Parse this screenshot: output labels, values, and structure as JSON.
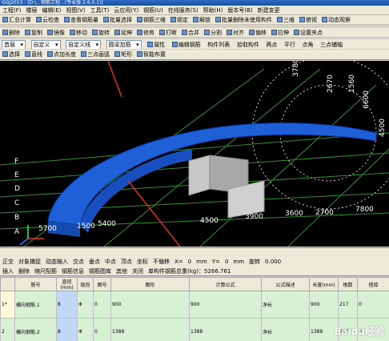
{
  "window": {
    "title": "GGJ2013 - [D:\\...钢筋工程...(专业版 2.6.0.1)]"
  },
  "menu": [
    "工程(F)",
    "楼层",
    "编辑(E)",
    "视图(V)",
    "工具(T)",
    "云应用(Y)",
    "钢筋(U)",
    "在线服务(S)",
    "帮助(H)",
    "版本号(B)",
    "新建变更"
  ],
  "toolbar1": [
    "汇总计算",
    "云检查",
    "查看钢筋量",
    "批量选择",
    "钢筋三维",
    "锁定",
    "解锁",
    "批量删除未使用构件",
    "三维",
    "俯视",
    "动态观察"
  ],
  "toolbar2": [
    "删除",
    "复制",
    "镜像",
    "移动",
    "旋转",
    "延伸",
    "修剪",
    "打断",
    "合并",
    "分割",
    "对齐",
    "偏移",
    "拉伸",
    "设置夹点"
  ],
  "selectors": {
    "floor": "首层",
    "category": "自定义",
    "type": "自定义线",
    "name": "圆梁加筋",
    "props": "属性",
    "edit": "编辑钢筋",
    "list": "构件列表",
    "pick": "拾取构件",
    "twopoint": "两点",
    "parallel": "平行",
    "corner": "点角",
    "three": "三点辅轴"
  },
  "drawbar": [
    "选择",
    "直线",
    "点加长度",
    "三点画弧",
    "矩形",
    "智能布置"
  ],
  "viewport": {
    "left_axes": [
      "F",
      "E",
      "D",
      "C",
      "B",
      "A"
    ],
    "bottom_dims": [
      "5700",
      "1500",
      "5400",
      "4500",
      "3900",
      "3600",
      "2700",
      "7800"
    ],
    "top_dims": [
      "3780",
      "2670",
      "1560",
      "6600",
      "4500"
    ],
    "colors": {
      "beam": "#1f5fd8",
      "grid": "#2f8f2f",
      "wall": "#c8c8c8"
    }
  },
  "statusbar": [
    "正交",
    "对象捕捉",
    "动态输入",
    "交点",
    "垂点",
    "中点",
    "顶点",
    "坐标",
    "不偏移",
    "X=",
    "0",
    "mm",
    "Y=",
    "0",
    "mm",
    "旋转",
    "0.000"
  ],
  "rebarbar": {
    "buttons": [
      "插入",
      "删除",
      "缩尺配筋",
      "钢筋信息",
      "钢筋图库",
      "其他",
      "关闭"
    ],
    "total": "单构件钢筋总重(kg)：5266.761"
  },
  "table": {
    "headers": [
      "",
      "筋号",
      "直径(mm)",
      "级别",
      "图号",
      "图形",
      "计算公式",
      "公式描述",
      "长度(mm)",
      "根数",
      "搭接"
    ],
    "rows": [
      {
        "idx": "1*",
        "name": "横向钢筋.1",
        "dia": "8",
        "grade": "Φ",
        "fig": "0",
        "shape": "900",
        "formula": "900",
        "desc": "净长",
        "len": "900",
        "count": "217",
        "lap": "0"
      },
      {
        "idx": "2",
        "name": "横向钢筋.2",
        "dia": "8",
        "grade": "Φ",
        "fig": "0",
        "shape": "1388",
        "formula": "1388",
        "desc": "净长",
        "len": "1388",
        "count": "217",
        "lap": "0"
      }
    ]
  },
  "watermark": "Baidu经验"
}
